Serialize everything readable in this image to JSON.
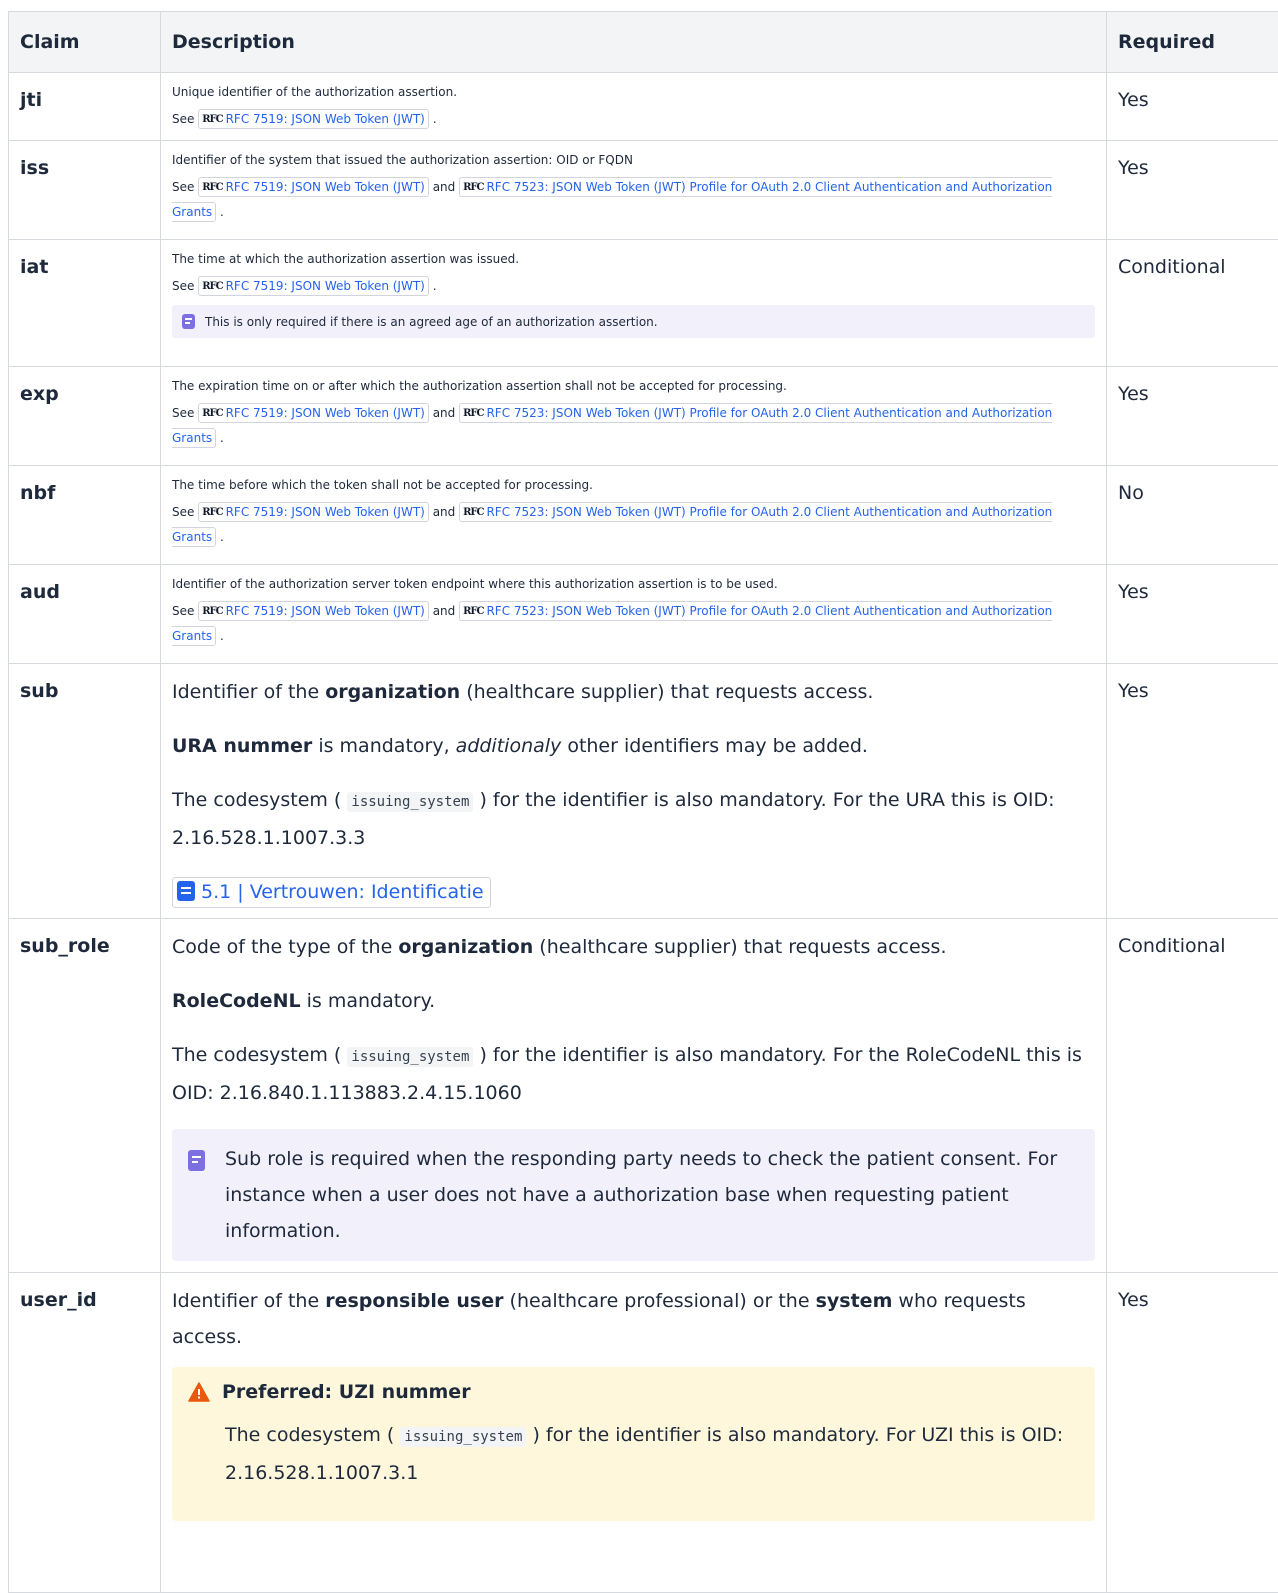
{
  "headers": {
    "claim": "Claim",
    "description": "Description",
    "required": "Required"
  },
  "common": {
    "see": "See",
    "and": "and",
    "period": ".",
    "rfc_logo": "RFC",
    "rfc7519": "RFC 7519: JSON Web Token (JWT)",
    "rfc7523": "RFC 7523: JSON Web Token (JWT) Profile for OAuth 2.0 Client Authentication and Authorization Grants"
  },
  "rows": [
    {
      "claim": "jti",
      "required": "Yes",
      "text": "Unique identifier of the authorization assertion."
    },
    {
      "claim": "iss",
      "required": "Yes",
      "text": "Identifier of the system that issued the authorization assertion: OID or FQDN"
    },
    {
      "claim": "iat",
      "required": "Conditional",
      "text": "The time at which the authorization assertion was issued.",
      "note": "This is only required if there is an agreed age of an authorization assertion."
    },
    {
      "claim": "exp",
      "required": "Yes",
      "text": "The expiration time on or after which the authorization assertion shall not be accepted for processing."
    },
    {
      "claim": "nbf",
      "required": "No",
      "text": "The time before which the token shall not be accepted for processing."
    },
    {
      "claim": "aud",
      "required": "Yes",
      "text": "Identifier of the authorization server token endpoint where this authorization assertion is to be used."
    }
  ],
  "sub": {
    "claim": "sub",
    "required": "Yes",
    "p1_a": "Identifier of the ",
    "p1_b": "organization",
    "p1_c": " (healthcare supplier) that requests access.",
    "p2_a": "URA nummer",
    "p2_b": " is mandatory, ",
    "p2_c": "additionaly",
    "p2_d": " other identifiers may be added.",
    "p3_a": "The codesystem (",
    "p3_code": "issuing_system",
    "p3_b": ") for the identifier is also mandatory. For the URA this is OID: 2.16.528.1.1007.3.3",
    "link": "5.1 | Vertrouwen: Identificatie"
  },
  "sub_role": {
    "claim": "sub_role",
    "required": "Conditional",
    "p1_a": "Code of the type of the ",
    "p1_b": "organization",
    "p1_c": " (healthcare supplier) that requests access.",
    "p2_a": "RoleCodeNL",
    "p2_b": " is mandatory.",
    "p3_a": "The codesystem (",
    "p3_code": "issuing_system",
    "p3_b": ") for the identifier is also mandatory. For the RoleCodeNL this is OID: 2.16.840.1.113883.2.4.15.1060",
    "note": "Sub role is required when the responding party needs to check the patient consent. For instance when a user does not have a authorization base when requesting patient information."
  },
  "user_id": {
    "claim": "user_id",
    "required": "Yes",
    "p1_a": "Identifier of the ",
    "p1_b": "responsible user",
    "p1_c": " (healthcare professional) or the ",
    "p1_d": "system",
    "p1_e": " who requests access.",
    "warn_title": "Preferred: UZI nummer",
    "warn_a": "The codesystem (",
    "warn_code": "issuing_system",
    "warn_b": ") for the identifier is also mandatory. For UZI this is OID: 2.16.528.1.1007.3.1"
  },
  "colors": {
    "link": "#2563eb",
    "note_bg": "#f1f0fb",
    "note_icon": "#7c6fe0",
    "warn_bg": "#fef7dc",
    "warn_icon": "#ea580c",
    "header_bg": "#f3f4f6",
    "border": "#d6d9de"
  }
}
